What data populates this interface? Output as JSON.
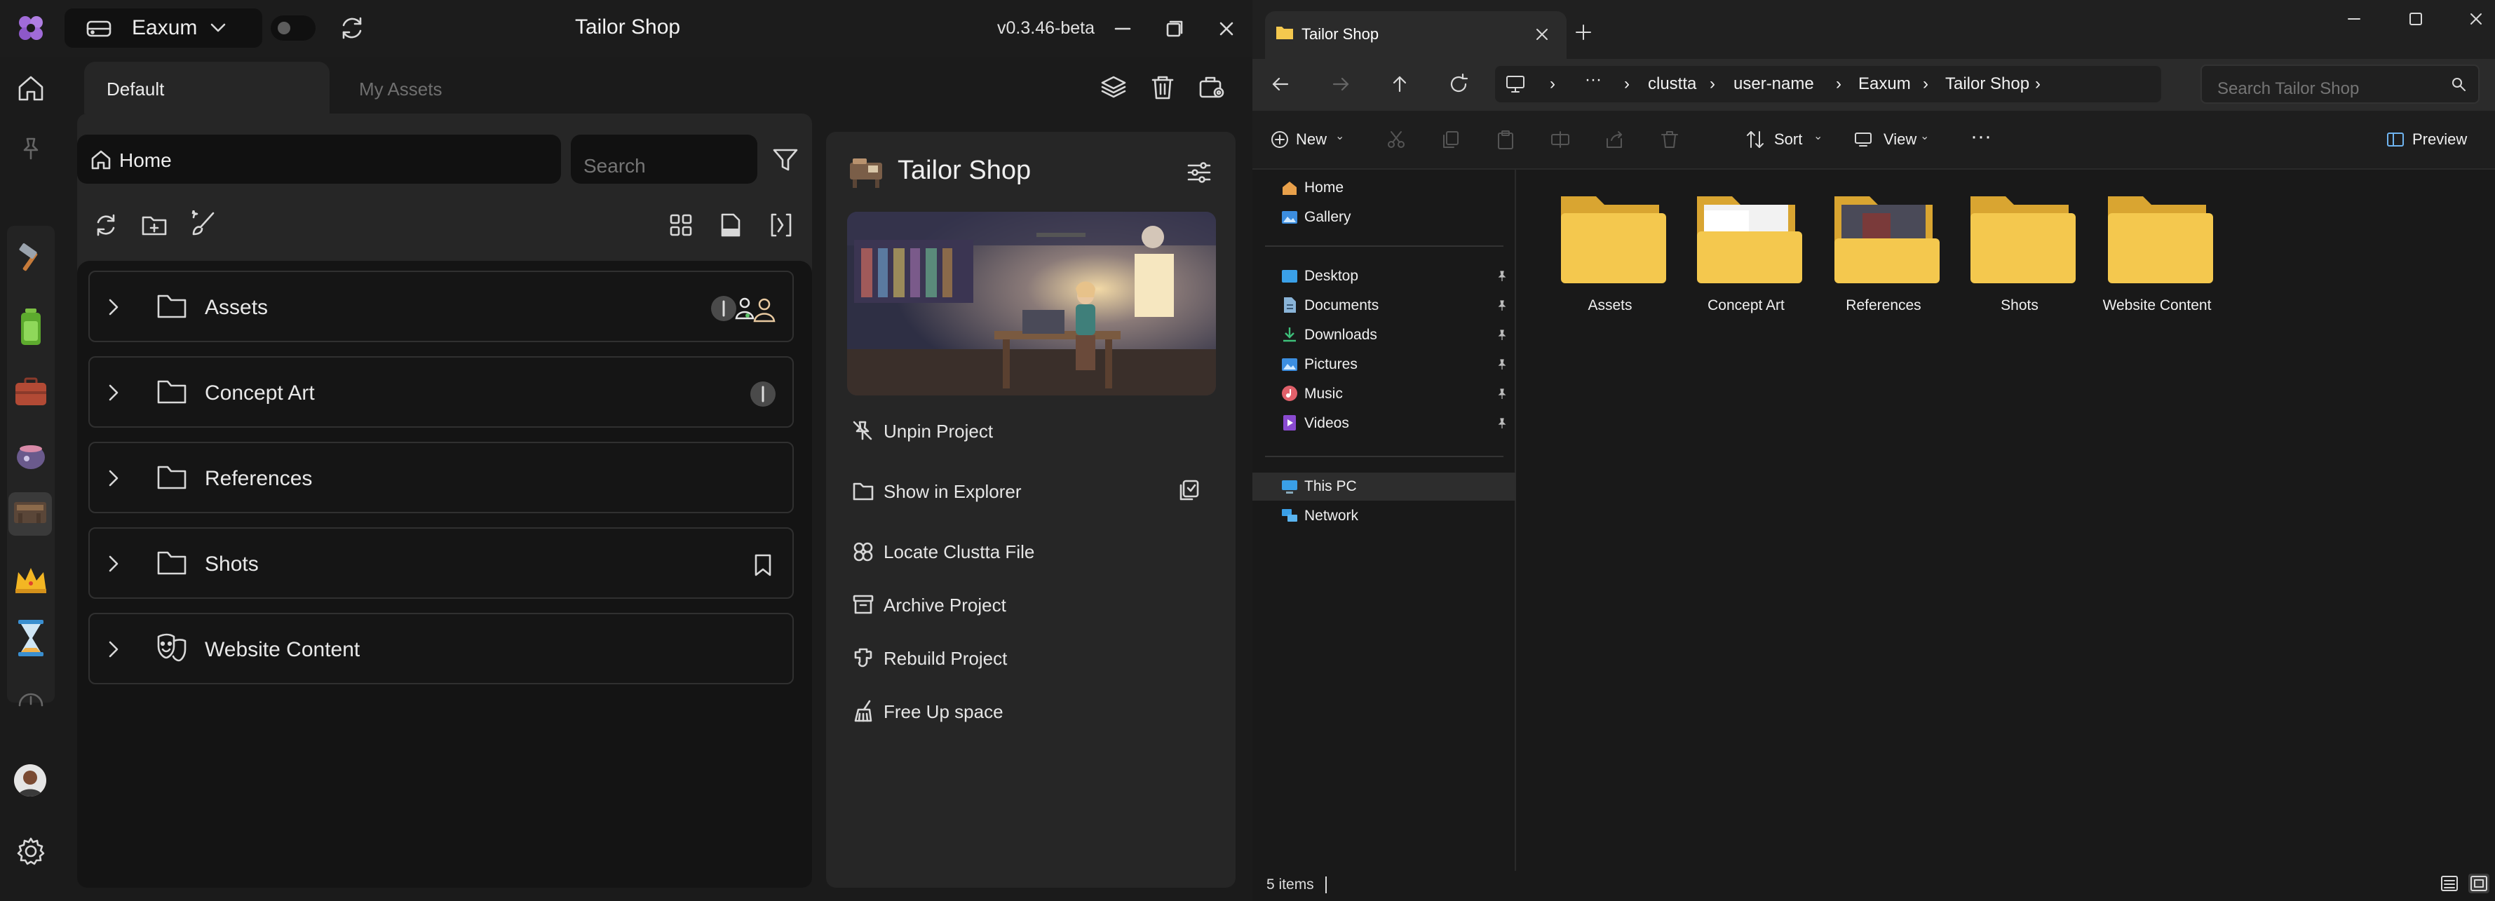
{
  "app": {
    "title": "Tailor Shop",
    "version": "v0.3.46-beta",
    "workspace": "Eaxum",
    "tabs": [
      {
        "label": "Default",
        "active": true
      },
      {
        "label": "My Assets",
        "active": false
      }
    ],
    "home_label": "Home",
    "search_placeholder": "Search",
    "folders": [
      {
        "name": "Assets"
      },
      {
        "name": "Concept Art"
      },
      {
        "name": "References"
      },
      {
        "name": "Shots"
      },
      {
        "name": "Website Content"
      }
    ],
    "project": {
      "title": "Tailor Shop",
      "actions": [
        {
          "label": "Unpin Project",
          "icon": "unpin-icon"
        },
        {
          "label": "Show in Explorer",
          "icon": "folder-icon"
        },
        {
          "label": "Locate Clustta File",
          "icon": "locate-icon"
        },
        {
          "label": "Archive Project",
          "icon": "archive-icon"
        },
        {
          "label": "Rebuild Project",
          "icon": "rebuild-icon"
        },
        {
          "label": "Free Up space",
          "icon": "broom-icon"
        }
      ]
    },
    "colors": {
      "accent": "#a06bd8",
      "panel": "#262626",
      "list_bg": "#141414"
    }
  },
  "explorer": {
    "tab_title": "Tailor Shop",
    "breadcrumbs": [
      "clustta",
      "user-name",
      "Eaxum",
      "Tailor Shop"
    ],
    "search_placeholder": "Search Tailor Shop",
    "commands": {
      "new": "New",
      "sort": "Sort",
      "view": "View",
      "preview": "Preview"
    },
    "nav": {
      "top": [
        "Home",
        "Gallery"
      ],
      "pinned": [
        "Desktop",
        "Documents",
        "Downloads",
        "Pictures",
        "Music",
        "Videos"
      ],
      "bottom": [
        "This PC",
        "Network"
      ]
    },
    "items": [
      "Assets",
      "Concept Art",
      "References",
      "Shots",
      "Website Content"
    ],
    "status": "5 items",
    "colors": {
      "folder": "#f4c84e",
      "folder_back": "#d9a531"
    }
  }
}
